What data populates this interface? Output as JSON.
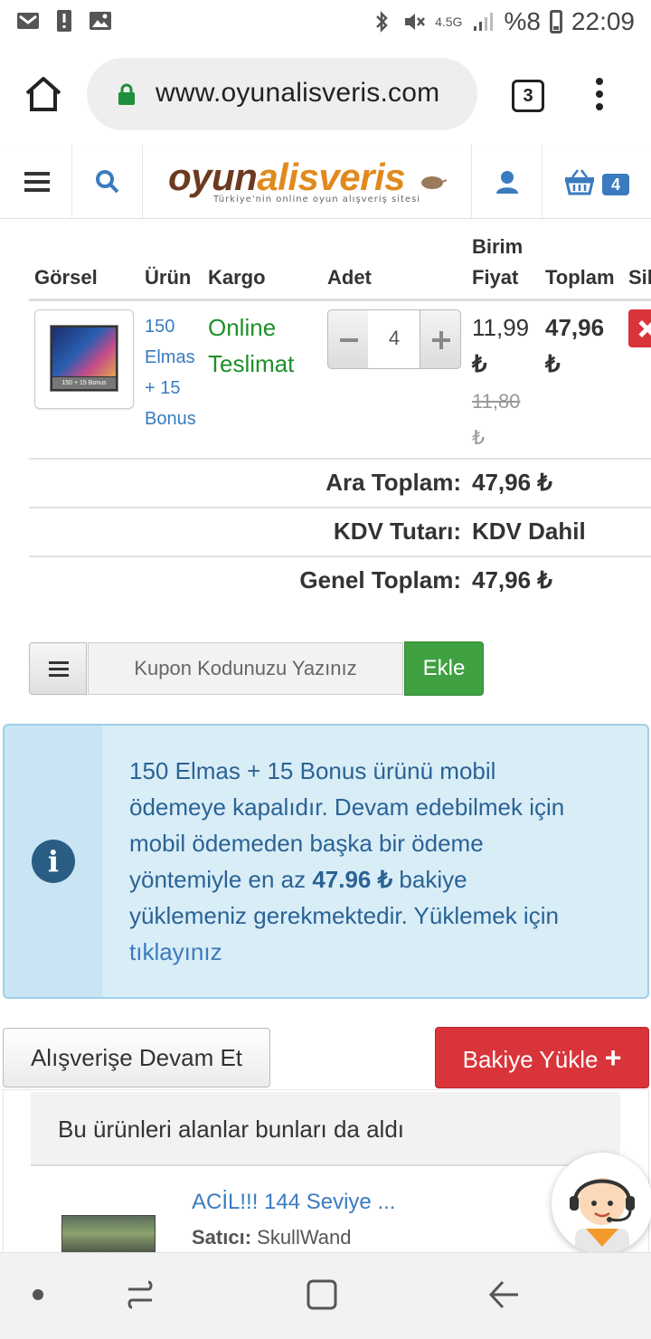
{
  "status_bar": {
    "network": "4.5G",
    "battery": "%8",
    "time": "22:09"
  },
  "browser": {
    "url": "www.oyunalisveris.com",
    "tab_count": "3"
  },
  "site": {
    "logo_part1": "oyun",
    "logo_part2": "alisveris",
    "tagline": "Türkiye'nin online oyun alışveriş sitesi",
    "cart_count": "4"
  },
  "cart": {
    "headers": {
      "image": "Görsel",
      "product": "Ürün",
      "shipping": "Kargo",
      "quantity": "Adet",
      "unit_price_1": "Birim",
      "unit_price_2": "Fiyat",
      "total": "Toplam",
      "delete": "Sil"
    },
    "item": {
      "thumbnail_caption": "150 + 15 Bonus",
      "name_lines": [
        "150",
        "Elmas",
        "+ 15",
        "Bonus"
      ],
      "shipping_lines": [
        "Online",
        "Teslimat"
      ],
      "quantity": "4",
      "unit_price_lines": [
        "11,99",
        "₺"
      ],
      "old_price_lines": [
        "11,80",
        "₺"
      ],
      "total_lines": [
        "47,96",
        "₺"
      ]
    },
    "summary": {
      "subtotal_label": "Ara Toplam:",
      "subtotal_value": "47,96 ₺",
      "vat_label": "KDV Tutarı:",
      "vat_value": "KDV Dahil",
      "grand_total_label": "Genel Toplam:",
      "grand_total_value": "47,96 ₺"
    }
  },
  "coupon": {
    "placeholder": "Kupon Kodunuzu Yazınız",
    "add_label": "Ekle"
  },
  "alert": {
    "lines": [
      "150 Elmas + 15 Bonus ürünü mobil",
      "ödemeye kapalıdır. Devam edebilmek için",
      "mobil ödemeden başka bir ödeme"
    ],
    "line4_prefix": "yöntemiyle en az ",
    "line4_amount": "47.96 ₺",
    "line4_suffix": " bakiye",
    "line5": "yüklemeniz gerekmektedir. Yüklemek için",
    "link_text": "tıklayınız"
  },
  "actions": {
    "continue_label": "Alışverişe Devam Et",
    "topup_label": "Bakiye Yükle",
    "topup_plus": "+"
  },
  "recommendations": {
    "title": "Bu ürünleri alanlar bunları da aldı",
    "item_name": "ACİL!!! 144 Seviye ...",
    "seller_label": "Satıcı:",
    "seller_name": " SkullWand"
  },
  "colors": {
    "link_blue": "#3a7bbf",
    "success_green": "#3fa142",
    "danger_red": "#d9343a",
    "info_bg": "#d9edf7",
    "logo_brown": "#6b3a1f",
    "logo_orange": "#e08a1e"
  }
}
